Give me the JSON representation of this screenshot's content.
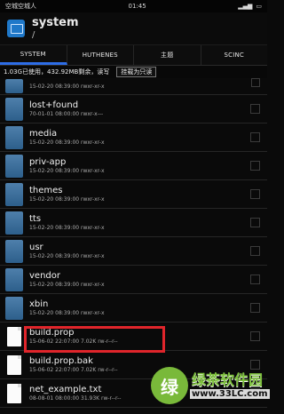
{
  "status": {
    "left": "空城空城人",
    "time": "01:45",
    "right": "▮▮▮"
  },
  "app": {
    "title": "system",
    "path": "/"
  },
  "tabs": [
    "SYSTEM",
    "HUTHENES",
    "主题",
    "SCINC"
  ],
  "info": {
    "summary": "1.03G已使用，432.92MB剩余，读写",
    "button": "挂载为只读"
  },
  "files": [
    {
      "name": "lost+found",
      "meta": "70-01-01 08:00:00  rwxr-x---",
      "type": "folder"
    },
    {
      "name": "media",
      "meta": "15-02-20 08:39:00  rwxr-xr-x",
      "type": "folder"
    },
    {
      "name": "priv-app",
      "meta": "15-02-20 08:39:00  rwxr-xr-x",
      "type": "folder"
    },
    {
      "name": "themes",
      "meta": "15-02-20 08:39:00  rwxr-xr-x",
      "type": "folder"
    },
    {
      "name": "tts",
      "meta": "15-02-20 08:39:00  rwxr-xr-x",
      "type": "folder"
    },
    {
      "name": "usr",
      "meta": "15-02-20 08:39:00  rwxr-xr-x",
      "type": "folder"
    },
    {
      "name": "vendor",
      "meta": "15-02-20 08:39:00  rwxr-xr-x",
      "type": "folder"
    },
    {
      "name": "xbin",
      "meta": "15-02-20 08:39:00  rwxr-xr-x",
      "type": "folder"
    },
    {
      "name": "build.prop",
      "meta": "15-06-02 22:07:00  7.02K  rw-r--r--",
      "type": "file"
    },
    {
      "name": "build.prop.bak",
      "meta": "15-06-02 22:07:00  7.02K  rw-r--r--",
      "type": "file"
    },
    {
      "name": "net_example.txt",
      "meta": "08-08-01 08:00:00  31.93K  rw-r--r--",
      "type": "file"
    }
  ],
  "partial_meta": "15-02-20 08:39:00  rwxr-xr-x",
  "watermark": {
    "logo": "绿",
    "name": "绿茶软件园",
    "url": "www.33LC.com"
  }
}
